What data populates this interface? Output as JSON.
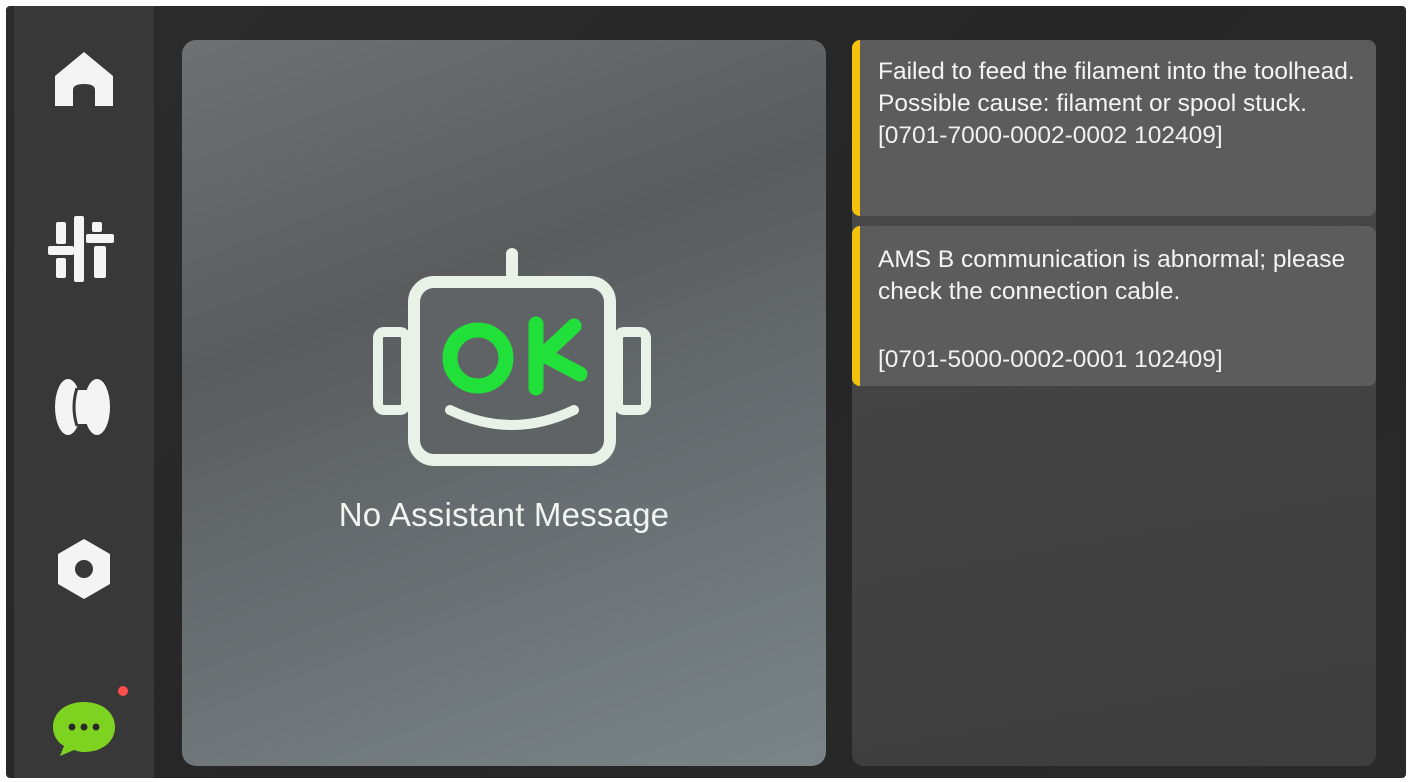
{
  "sidebar": {
    "items": [
      {
        "icon": "home-icon",
        "active": false
      },
      {
        "icon": "controls-icon",
        "active": false
      },
      {
        "icon": "filament-spool-icon",
        "active": false
      },
      {
        "icon": "settings-nut-icon",
        "active": false
      },
      {
        "icon": "assistant-chat-icon",
        "active": true,
        "has_notification": true
      }
    ]
  },
  "assistant": {
    "status_text": "No Assistant Message",
    "robot_face_text": "OK"
  },
  "messages": [
    {
      "text": "Failed to feed the filament into the toolhead. Possible cause: filament or spool stuck.",
      "code": "[0701-7000-0002-0002 102409]",
      "level": "warning"
    },
    {
      "text": "AMS B communication is abnormal; please check the connection cable.",
      "code": "[0701-5000-0002-0001 102409]",
      "level": "warning"
    }
  ],
  "colors": {
    "accent_green": "#7ed321",
    "robot_green": "#22e03a",
    "warning_yellow": "#f4c20d",
    "notification_red": "#ff4d4d"
  }
}
